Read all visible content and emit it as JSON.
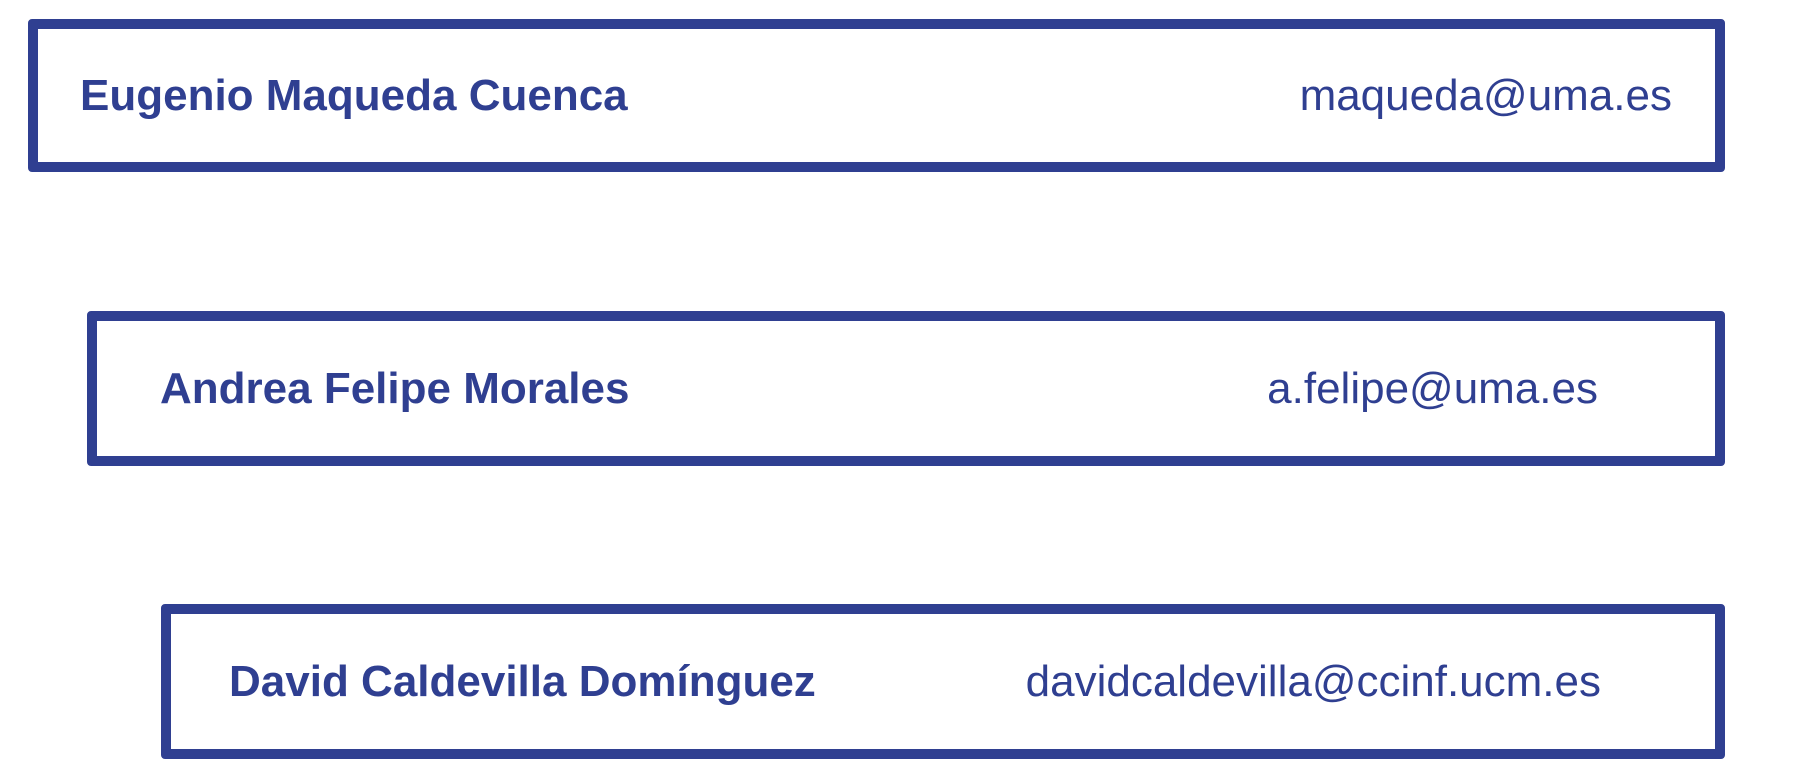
{
  "colors": {
    "accent": "#2f3f91",
    "background": "#ffffff"
  },
  "contacts": [
    {
      "name": "Eugenio Maqueda Cuenca",
      "email": "maqueda@uma.es"
    },
    {
      "name": "Andrea Felipe Morales",
      "email": "a.felipe@uma.es"
    },
    {
      "name": "David Caldevilla Domínguez",
      "email": "davidcaldevilla@ccinf.ucm.es"
    }
  ]
}
